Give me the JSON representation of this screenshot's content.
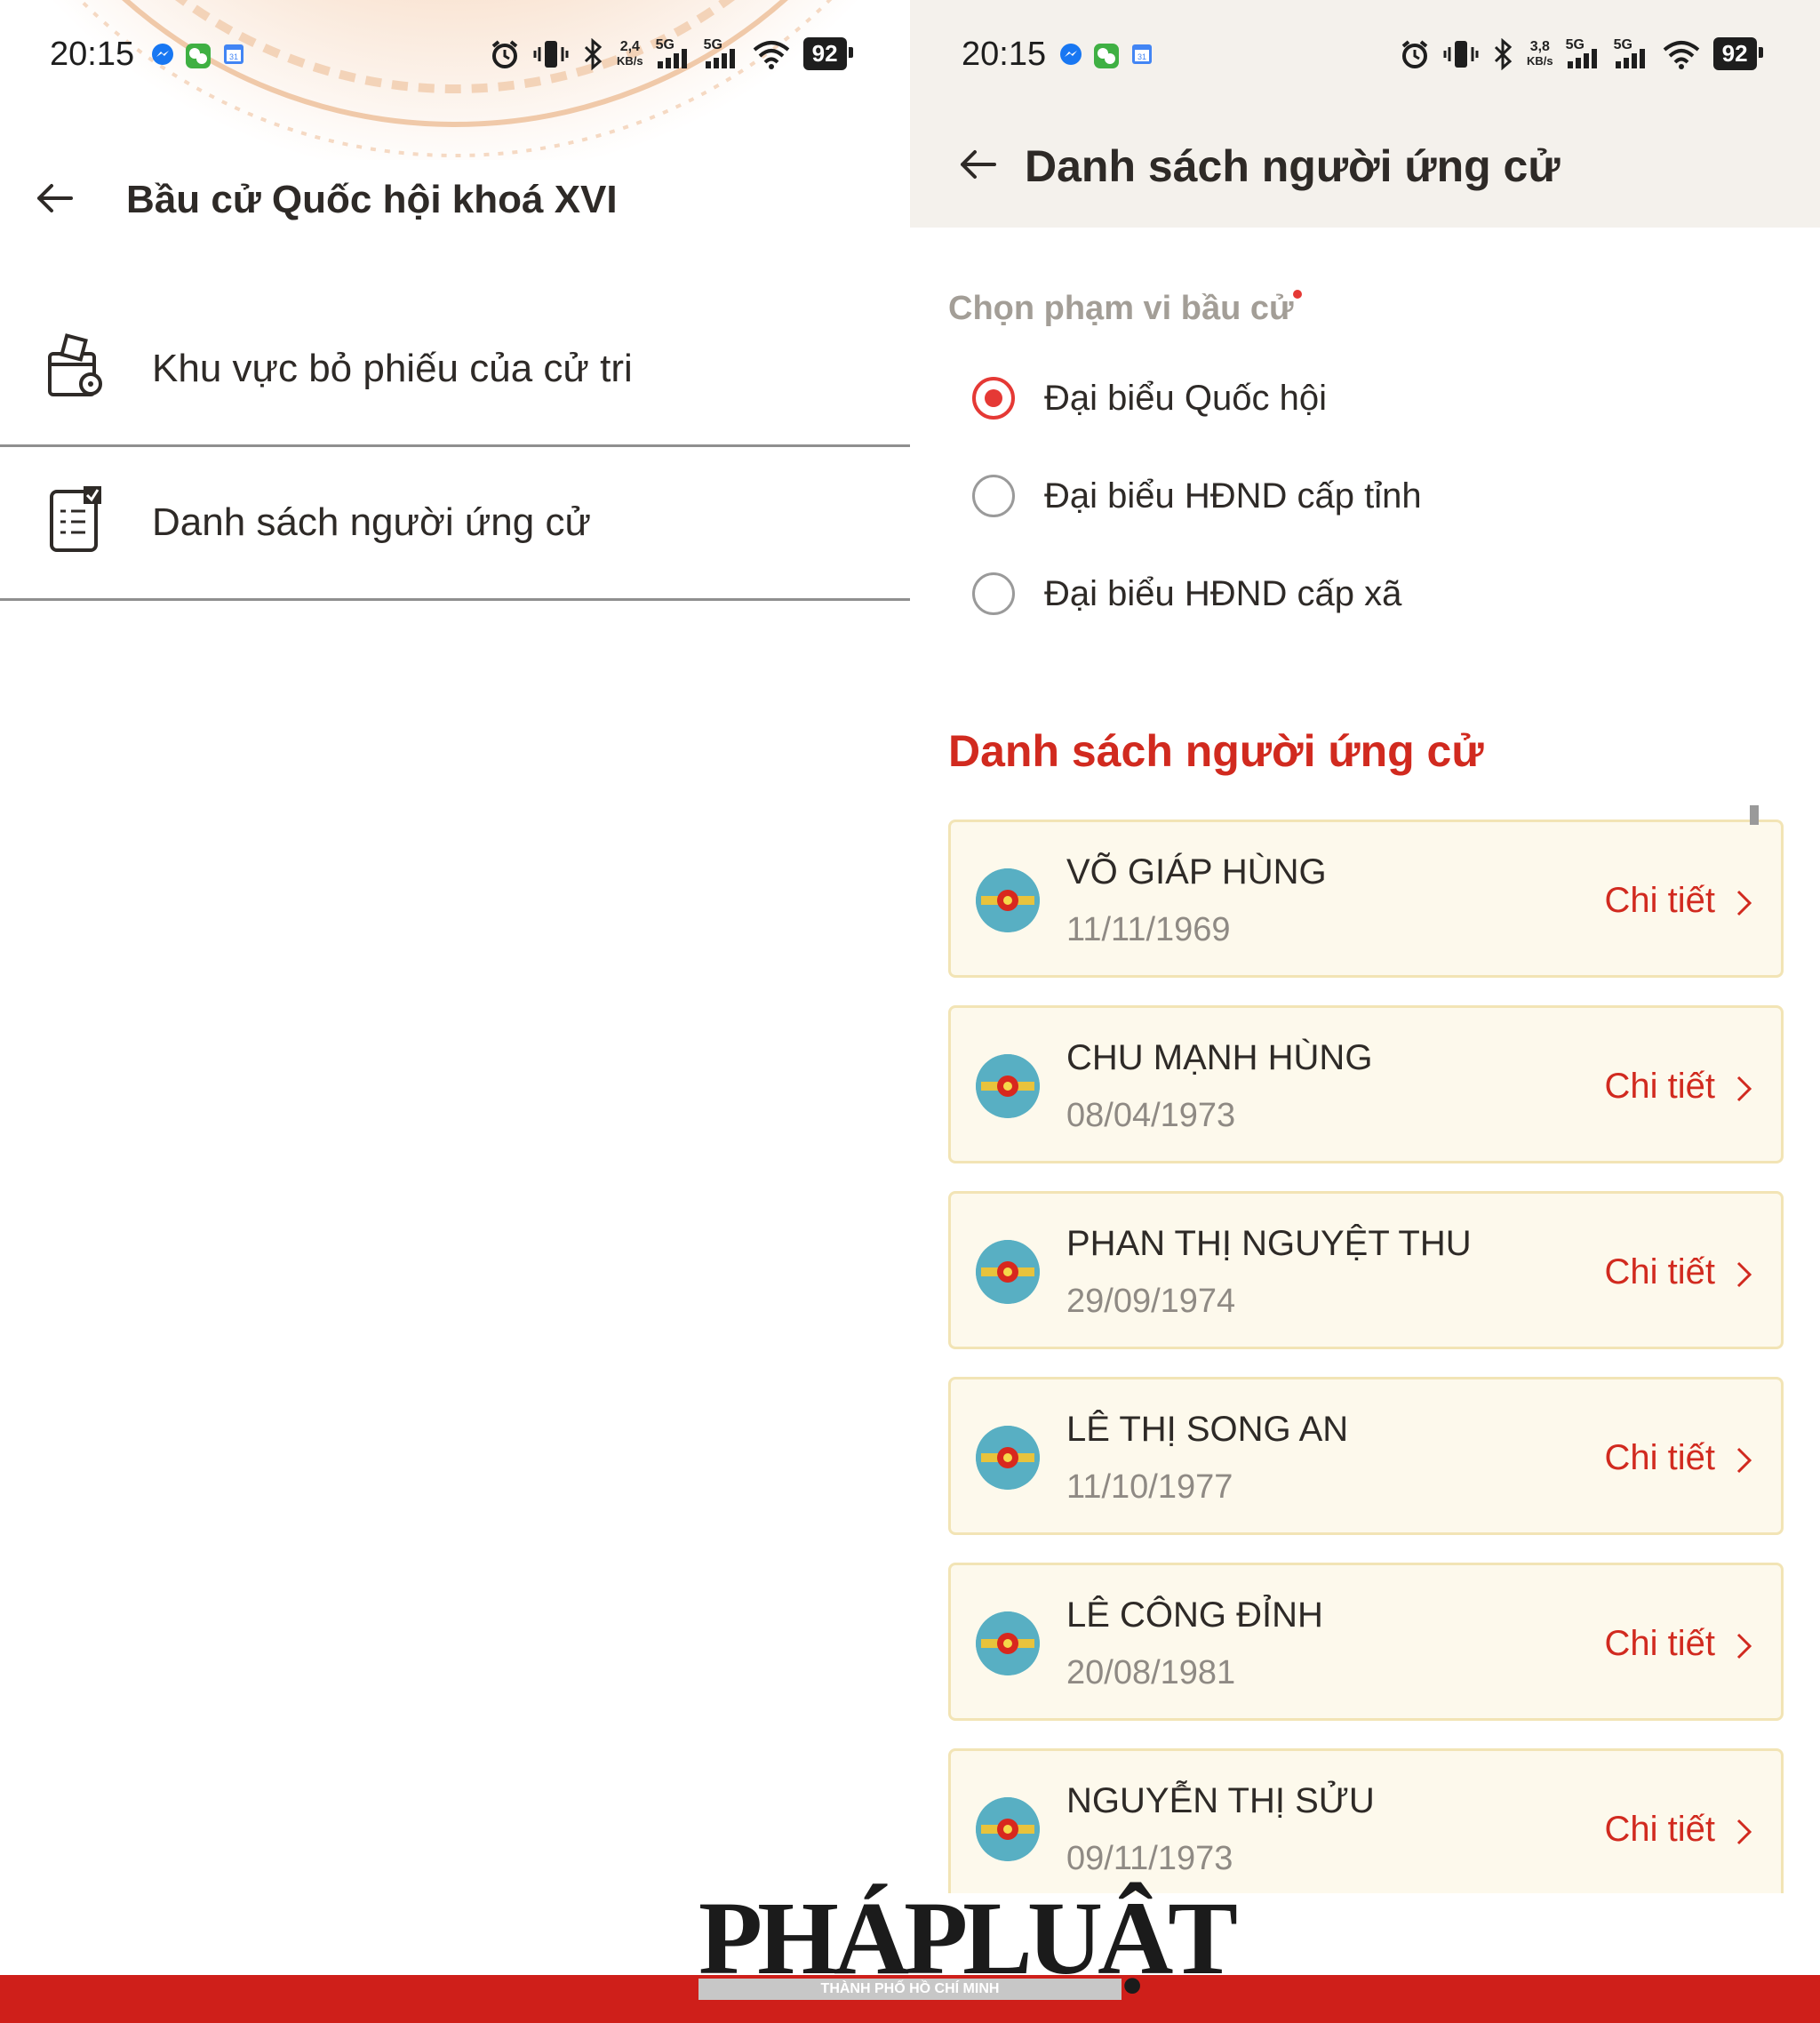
{
  "status_left": {
    "time": "20:15",
    "net_speed": "2,4",
    "net_unit": "KB/s",
    "sig1": "5G",
    "sig2": "5G",
    "battery": "92"
  },
  "status_right": {
    "time": "20:15",
    "net_speed": "3,8",
    "net_unit": "KB/s",
    "sig1": "5G",
    "sig2": "5G",
    "battery": "92"
  },
  "left_screen": {
    "title": "Bầu cử Quốc hội khoá XVI",
    "menu": [
      {
        "label": "Khu vực bỏ phiếu của cử tri",
        "icon": "ballot-box-location-icon"
      },
      {
        "label": "Danh sách người ứng cử",
        "icon": "checklist-icon"
      }
    ]
  },
  "right_screen": {
    "title": "Danh sách người ứng cử",
    "scope_label": "Chọn phạm vi bầu cử",
    "options": [
      {
        "label": "Đại biểu Quốc hội",
        "selected": true
      },
      {
        "label": "Đại biểu HĐND cấp tỉnh",
        "selected": false
      },
      {
        "label": "Đại biểu HĐND cấp xã",
        "selected": false
      }
    ],
    "list_title": "Danh sách người ứng cử",
    "detail_label": "Chi tiết",
    "candidates": [
      {
        "name": "VÕ GIÁP HÙNG",
        "dob": "11/11/1969"
      },
      {
        "name": "CHU MẠNH HÙNG",
        "dob": "08/04/1973"
      },
      {
        "name": "PHAN THỊ NGUYỆT THU",
        "dob": "29/09/1974"
      },
      {
        "name": "LÊ THỊ SONG AN",
        "dob": "11/10/1977"
      },
      {
        "name": "LÊ CÔNG ĐỈNH",
        "dob": "20/08/1981"
      },
      {
        "name": "NGUYỄN THỊ SỬU",
        "dob": "09/11/1973"
      }
    ]
  },
  "watermark": {
    "logo": "PHÁPLUẬT",
    "sub": "THÀNH PHỐ HỒ CHÍ MINH"
  },
  "colors": {
    "accent": "#d12a1f",
    "radio_on": "#e53935",
    "card_bg": "#fdf9ec",
    "card_border": "#f2e4b5",
    "header_bg": "#f4f1ec"
  }
}
